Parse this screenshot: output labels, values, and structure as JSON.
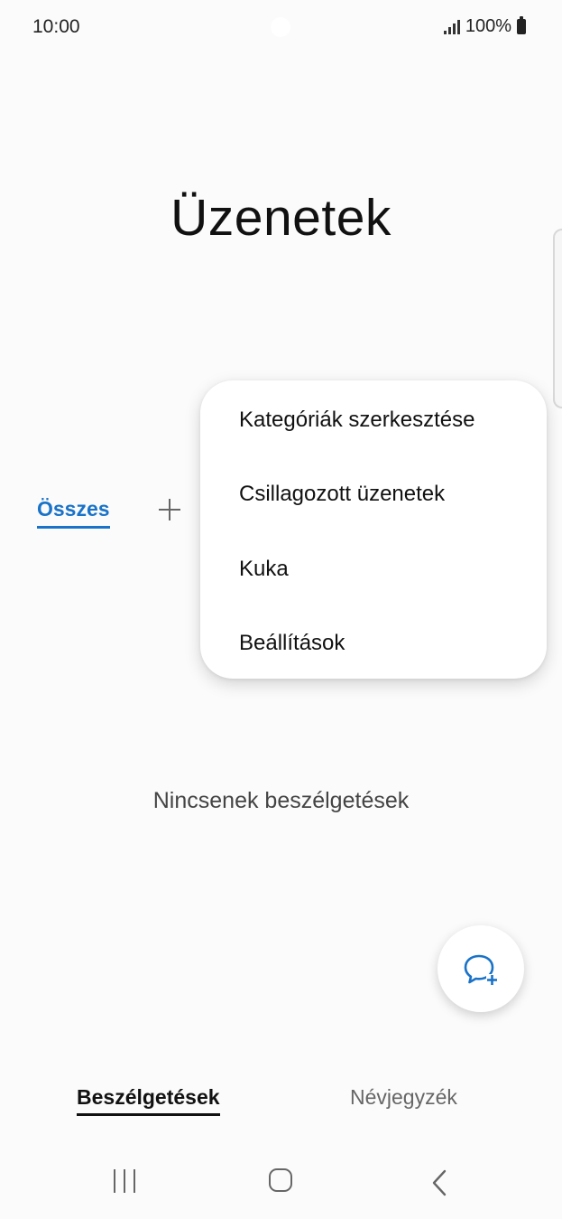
{
  "status_bar": {
    "time": "10:00",
    "battery_text": "100%",
    "icons": [
      "signal-icon",
      "battery-icon"
    ]
  },
  "header": {
    "title": "Üzenetek"
  },
  "category_tabs": {
    "active_label": "Összes",
    "add_icon": "plus-icon",
    "accent_color": "#1a73c8"
  },
  "overflow_menu": {
    "items": [
      {
        "label": "Kategóriák szerkesztése"
      },
      {
        "label": "Csillagozott üzenetek"
      },
      {
        "label": "Kuka"
      },
      {
        "label": "Beállítások"
      }
    ]
  },
  "main": {
    "empty_message": "Nincsenek beszélgetések"
  },
  "fab": {
    "icon": "new-message-icon",
    "color": "#1a73c8"
  },
  "bottom_tabs": {
    "items": [
      {
        "label": "Beszélgetések",
        "active": true
      },
      {
        "label": "Névjegyzék",
        "active": false
      }
    ]
  },
  "nav_bar": {
    "icons": [
      "recent-apps-icon",
      "home-icon",
      "back-icon"
    ]
  }
}
